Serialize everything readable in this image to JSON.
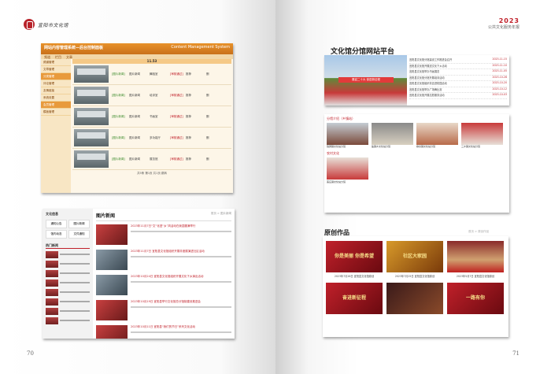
{
  "left": {
    "logo_text": "宜阳市文化馆",
    "page_number": "70",
    "cms": {
      "title": "网站内容管理系统—后台控制面板",
      "subtitle": "Content Management System",
      "nav": [
        "频道",
        "栏目",
        "文章"
      ],
      "bar_title": "11.53",
      "side": [
        "频道管理",
        "文章管理",
        "分类管理",
        "评论管理",
        "友情链接",
        "系统设置",
        "会员管理",
        "模板管理"
      ],
      "rows": [
        {
          "pub": "[图片新闻]",
          "cat": "图片新闻",
          "name": "舞蹈室",
          "status": "[审核通过]",
          "a": "推荐",
          "b": "删"
        },
        {
          "pub": "[图片新闻]",
          "cat": "图片新闻",
          "name": "培训室",
          "status": "[审核通过]",
          "a": "推荐",
          "b": "删"
        },
        {
          "pub": "[图片新闻]",
          "cat": "图片新闻",
          "name": "书画室",
          "status": "[审核通过]",
          "a": "推荐",
          "b": "删"
        },
        {
          "pub": "[图片新闻]",
          "cat": "图片新闻",
          "name": "多功能厅",
          "status": "[审核通过]",
          "a": "推荐",
          "b": "删"
        },
        {
          "pub": "[图片新闻]",
          "cat": "图片新闻",
          "name": "展览馆",
          "status": "[审核通过]",
          "a": "推荐",
          "b": "删"
        }
      ],
      "footer": "共5条  第1页  共1页  跳转"
    },
    "news": {
      "side_title": "文化信息",
      "buttons": [
        "通知公告",
        "图片新闻",
        "馆内动态",
        "文件通知"
      ],
      "hot_title": "热门新闻",
      "main_title": "图片新闻",
      "more": "首页 > 图片新闻",
      "items": [
        "2023年11月7日“文”化进“乡”风活动在我县圆满举行",
        "2023年11月7日 宜阳县文化馆组织开展非遗展演进社区活动",
        "2023年10月24日 宜阳县文化馆组织开展文化下乡演出活动",
        "2023年10月19日 宜阳县举行文化馆总分馆制建设推进会",
        "2023年10月11日 宜阳县“我们的节日”系列文化活动"
      ]
    }
  },
  "right": {
    "year": "2023",
    "year_sub": "公共文化服务年报",
    "page_number": "71",
    "site": {
      "title": "文化馆分馆网站平台",
      "banner": "喜迎二十大 奋进新征程",
      "list": [
        {
          "t": "宜阳县文化馆分馆建设工作推进会召开",
          "d": "2023-11-15"
        },
        {
          "t": "宜阳县文化馆开展送文化下乡活动",
          "d": "2023-11-10"
        },
        {
          "t": "宜阳县文化馆举办书画展览",
          "d": "2023-11-05"
        },
        {
          "t": "宜阳县文化馆分馆开展培训活动",
          "d": "2023-10-28"
        },
        {
          "t": "宜阳县文化馆组织非遗进校园活动",
          "d": "2023-10-20"
        },
        {
          "t": "宜阳县文化馆举办广场舞比赛",
          "d": "2023-10-12"
        },
        {
          "t": "宜阳县文化馆开展志愿服务活动",
          "d": "2023-10-03"
        }
      ]
    },
    "branch": {
      "caption": "分馆介绍（乡镇站）",
      "items": [
        "锦屏镇文化站分馆",
        "盐镇乡文化站分馆",
        "柳泉镇文化站分馆",
        "三乡镇文化站分馆"
      ],
      "single_caption": "农村文化",
      "single": "莲庄镇文化站分馆"
    },
    "works": {
      "title": "原创作品",
      "more": "首页 > 原创作品",
      "items": [
        {
          "ov": "你是美丽 你是希望",
          "t": "2023年7月26日 宜阳县文化馆原创"
        },
        {
          "ov": "社区大家园",
          "t": "2023年7月25日 宜阳县文化馆原创"
        },
        {
          "ov": "",
          "t": "2023年5月7日 宜阳县文化馆原创"
        },
        {
          "ov": "奋进新征程",
          "t": ""
        },
        {
          "ov": "",
          "t": ""
        },
        {
          "ov": "一路有你",
          "t": ""
        }
      ]
    }
  }
}
